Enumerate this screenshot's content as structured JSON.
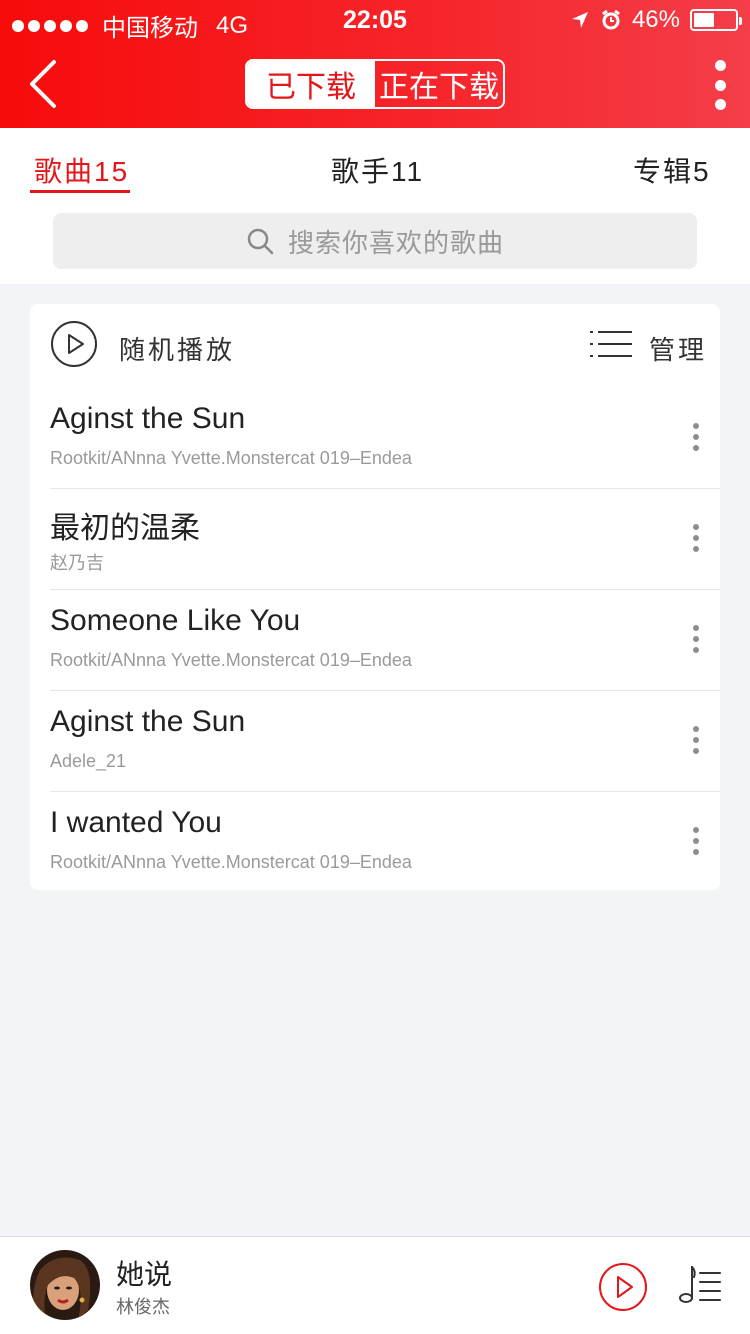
{
  "status_bar": {
    "carrier": "中国移动",
    "network": "4G",
    "time": "22:05",
    "battery": "46%",
    "battery_level": 0.46
  },
  "header": {
    "segments": [
      {
        "label": "已下载",
        "active": true
      },
      {
        "label": "正在下载",
        "active": false
      }
    ],
    "accent_color": "#f70b0b"
  },
  "tabs": [
    {
      "label": "歌曲15",
      "active": true
    },
    {
      "label": "歌手11",
      "active": false
    },
    {
      "label": "专辑5",
      "active": false
    }
  ],
  "search": {
    "placeholder": "搜索你喜欢的歌曲"
  },
  "list_header": {
    "shuffle_label": "随机播放",
    "manage_label": "管理"
  },
  "songs": [
    {
      "title": "Aginst the Sun",
      "artist": "Rootkit/ANnna Yvette.Monstercat 019–Endea"
    },
    {
      "title": "最初的温柔",
      "artist": "赵乃吉"
    },
    {
      "title": "Someone Like You",
      "artist": "Rootkit/ANnna Yvette.Monstercat 019–Endea"
    },
    {
      "title": "Aginst the Sun",
      "artist": "Adele_21"
    },
    {
      "title": "I wanted You",
      "artist": "Rootkit/ANnna Yvette.Monstercat 019–Endea"
    }
  ],
  "now_playing": {
    "title": "她说",
    "artist": "林俊杰"
  },
  "icons": {
    "back": "chevron-left-icon",
    "more": "more-vertical-icon",
    "search": "search-icon",
    "shuffle": "play-circle-icon",
    "manage": "list-icon",
    "song_menu": "more-vertical-icon",
    "player_play": "play-circle-icon",
    "playlist": "playlist-icon"
  }
}
